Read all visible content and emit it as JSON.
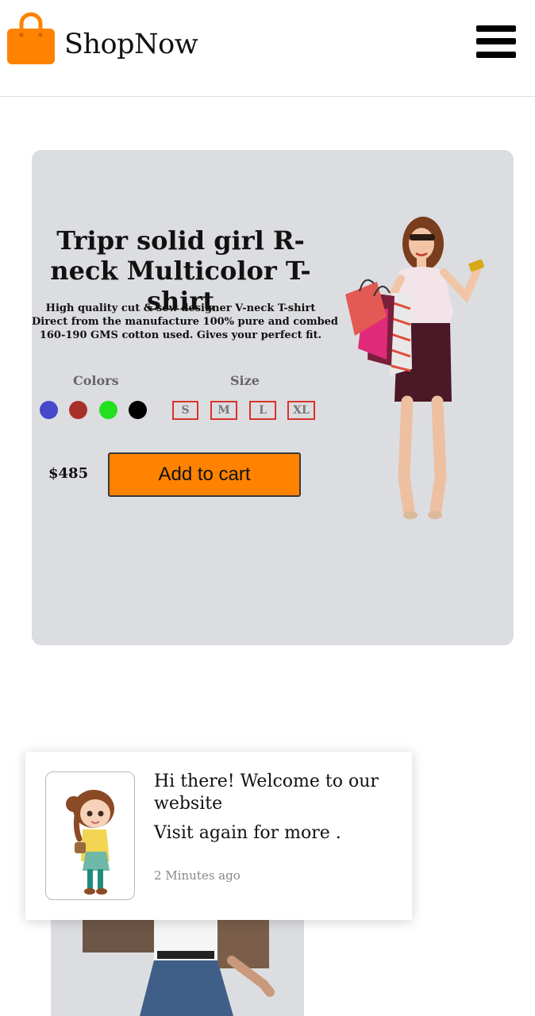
{
  "header": {
    "brand": "ShopNow",
    "logo_icon": "shopping-bag-icon",
    "menu_icon": "hamburger-menu-icon"
  },
  "product": {
    "title": "Tripr solid girl R-neck Multicolor T-shirt",
    "description_lines": [
      "High quality cut & sew designer V-neck T-shirt",
      "Direct from the manufacture 100% pure and combed",
      "160-190 GMS cotton used. Gives your perfect fit."
    ],
    "colors_label": "Colors",
    "size_label": "Size",
    "colors": [
      "#4747c9",
      "#a8302a",
      "#22e01f",
      "#000000"
    ],
    "sizes": [
      "S",
      "M",
      "L",
      "XL"
    ],
    "price": "$485",
    "cart_button": "Add to cart"
  },
  "toast": {
    "title": "Hi there! Welcome to our website",
    "subtitle": "Visit again for more .",
    "time": "2 Minutes ago"
  },
  "colors": {
    "accent": "#ff8200",
    "card_bg": "#dcdde0",
    "size_border": "#d9332b"
  }
}
